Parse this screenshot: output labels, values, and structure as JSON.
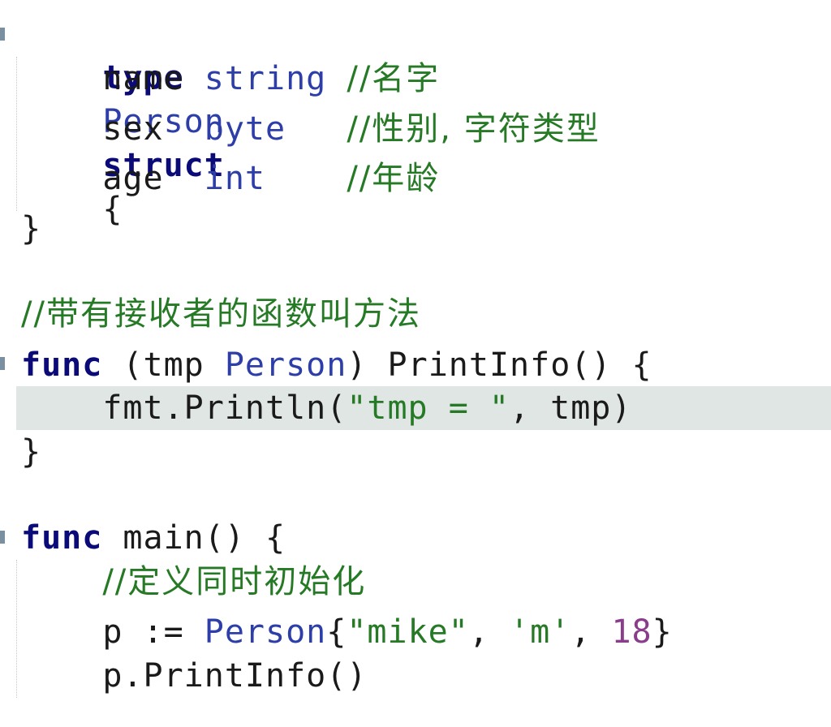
{
  "editor": {
    "line_kind": "go-source",
    "colors": {
      "keyword": "#0a0a78",
      "type": "#2d3ea8",
      "comment": "#267a26",
      "string": "#267a26",
      "number": "#8a3d8a",
      "highlight": "#dfe6e4"
    },
    "lines": {
      "l1": {
        "kw": "type",
        "name": "Person",
        "kw2": "struct",
        "brace": "{"
      },
      "l2": {
        "field": "name",
        "type": "string",
        "comment": "//名字"
      },
      "l3": {
        "field": "sex",
        "type": "byte",
        "comment": "//性别, 字符类型"
      },
      "l4": {
        "field": "age",
        "type": "int",
        "comment": "//年龄"
      },
      "l5": {
        "text": "}"
      },
      "l7": {
        "comment": "//带有接收者的函数叫方法"
      },
      "l8": {
        "kw": "func",
        "recv_open": "(tmp ",
        "recv_type": "Person",
        "recv_close": ")",
        "fname": "PrintInfo() {"
      },
      "l9": {
        "call": "fmt.Println(",
        "str": "\"tmp = \"",
        "rest": ", tmp)"
      },
      "l10": {
        "text": "}"
      },
      "l12": {
        "kw": "func",
        "rest": "main() {"
      },
      "l13": {
        "comment": "//定义同时初始化"
      },
      "l14": {
        "lhs": "p := ",
        "type": "Person",
        "open": "{",
        "s1": "\"mike\"",
        "sep1": ", ",
        "s2": "'m'",
        "sep2": ", ",
        "num": "18",
        "close": "}"
      },
      "l15": {
        "text": "p.PrintInfo()"
      }
    }
  }
}
